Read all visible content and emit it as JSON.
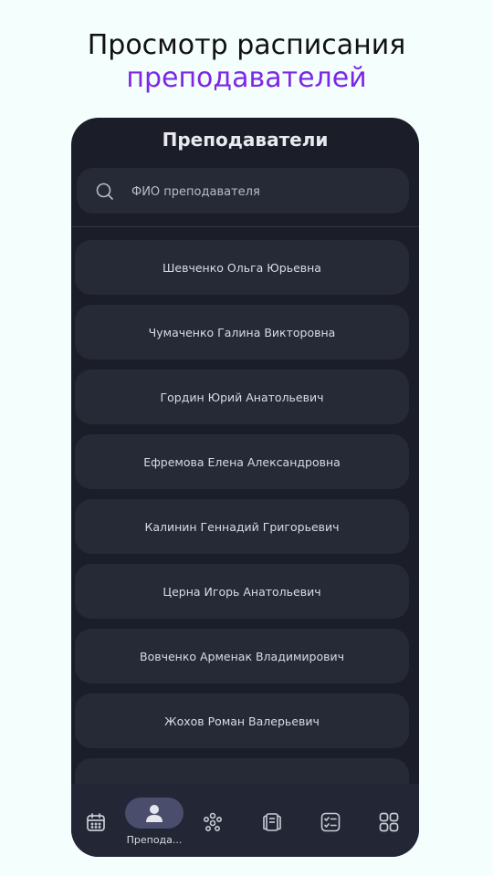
{
  "promo": {
    "line1": "Просмотр расписания",
    "line2": "преподавателей"
  },
  "screen": {
    "title": "Преподаватели",
    "search_placeholder": "ФИО преподавателя"
  },
  "teachers": [
    "Шевченко Ольга Юрьевна",
    "Чумаченко Галина Викторовна",
    "Гордин Юрий Анатольевич",
    "Ефремова Елена Александровна",
    "Калинин Геннадий Григорьевич",
    "Церна Игорь Анатольевич",
    "Вовченко Арменак Владимирович",
    "Жохов Роман Валерьевич"
  ],
  "nav": {
    "active_label": "Препода...",
    "items": [
      "calendar-icon",
      "person-icon",
      "groups-icon",
      "classroom-icon",
      "checklist-icon",
      "grid-icon"
    ]
  },
  "colors": {
    "accent": "#7c27e8",
    "phone_bg": "#1b1e29",
    "card_bg": "#262a37",
    "nav_active": "#4a4d6b"
  }
}
